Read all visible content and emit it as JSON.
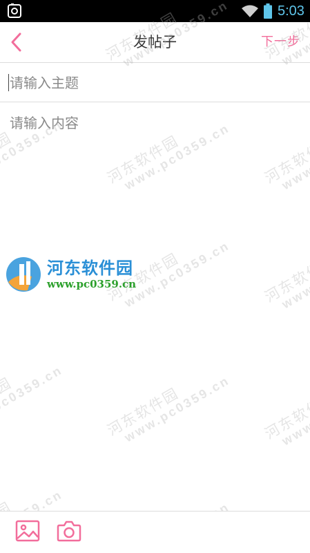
{
  "status_bar": {
    "time": "5:03",
    "left_icon": "screenshot-icon",
    "wifi_icon": "wifi-icon",
    "battery_icon": "battery-icon",
    "time_color": "#5fc5ea"
  },
  "header": {
    "title": "发帖子",
    "back_icon": "chevron-left-icon",
    "next_label": "下一步",
    "accent_color": "#f26d9b"
  },
  "form": {
    "subject_placeholder": "请输入主题",
    "subject_value": "",
    "content_placeholder": "请输入内容",
    "content_value": ""
  },
  "toolbar": {
    "image_icon": "image-icon",
    "camera_icon": "camera-icon"
  },
  "watermark": {
    "text_cn": "河东软件园",
    "text_url": "www.pc0359.cn",
    "logo_cn": "河东软件园",
    "logo_url": "www.pc0359.cn"
  }
}
